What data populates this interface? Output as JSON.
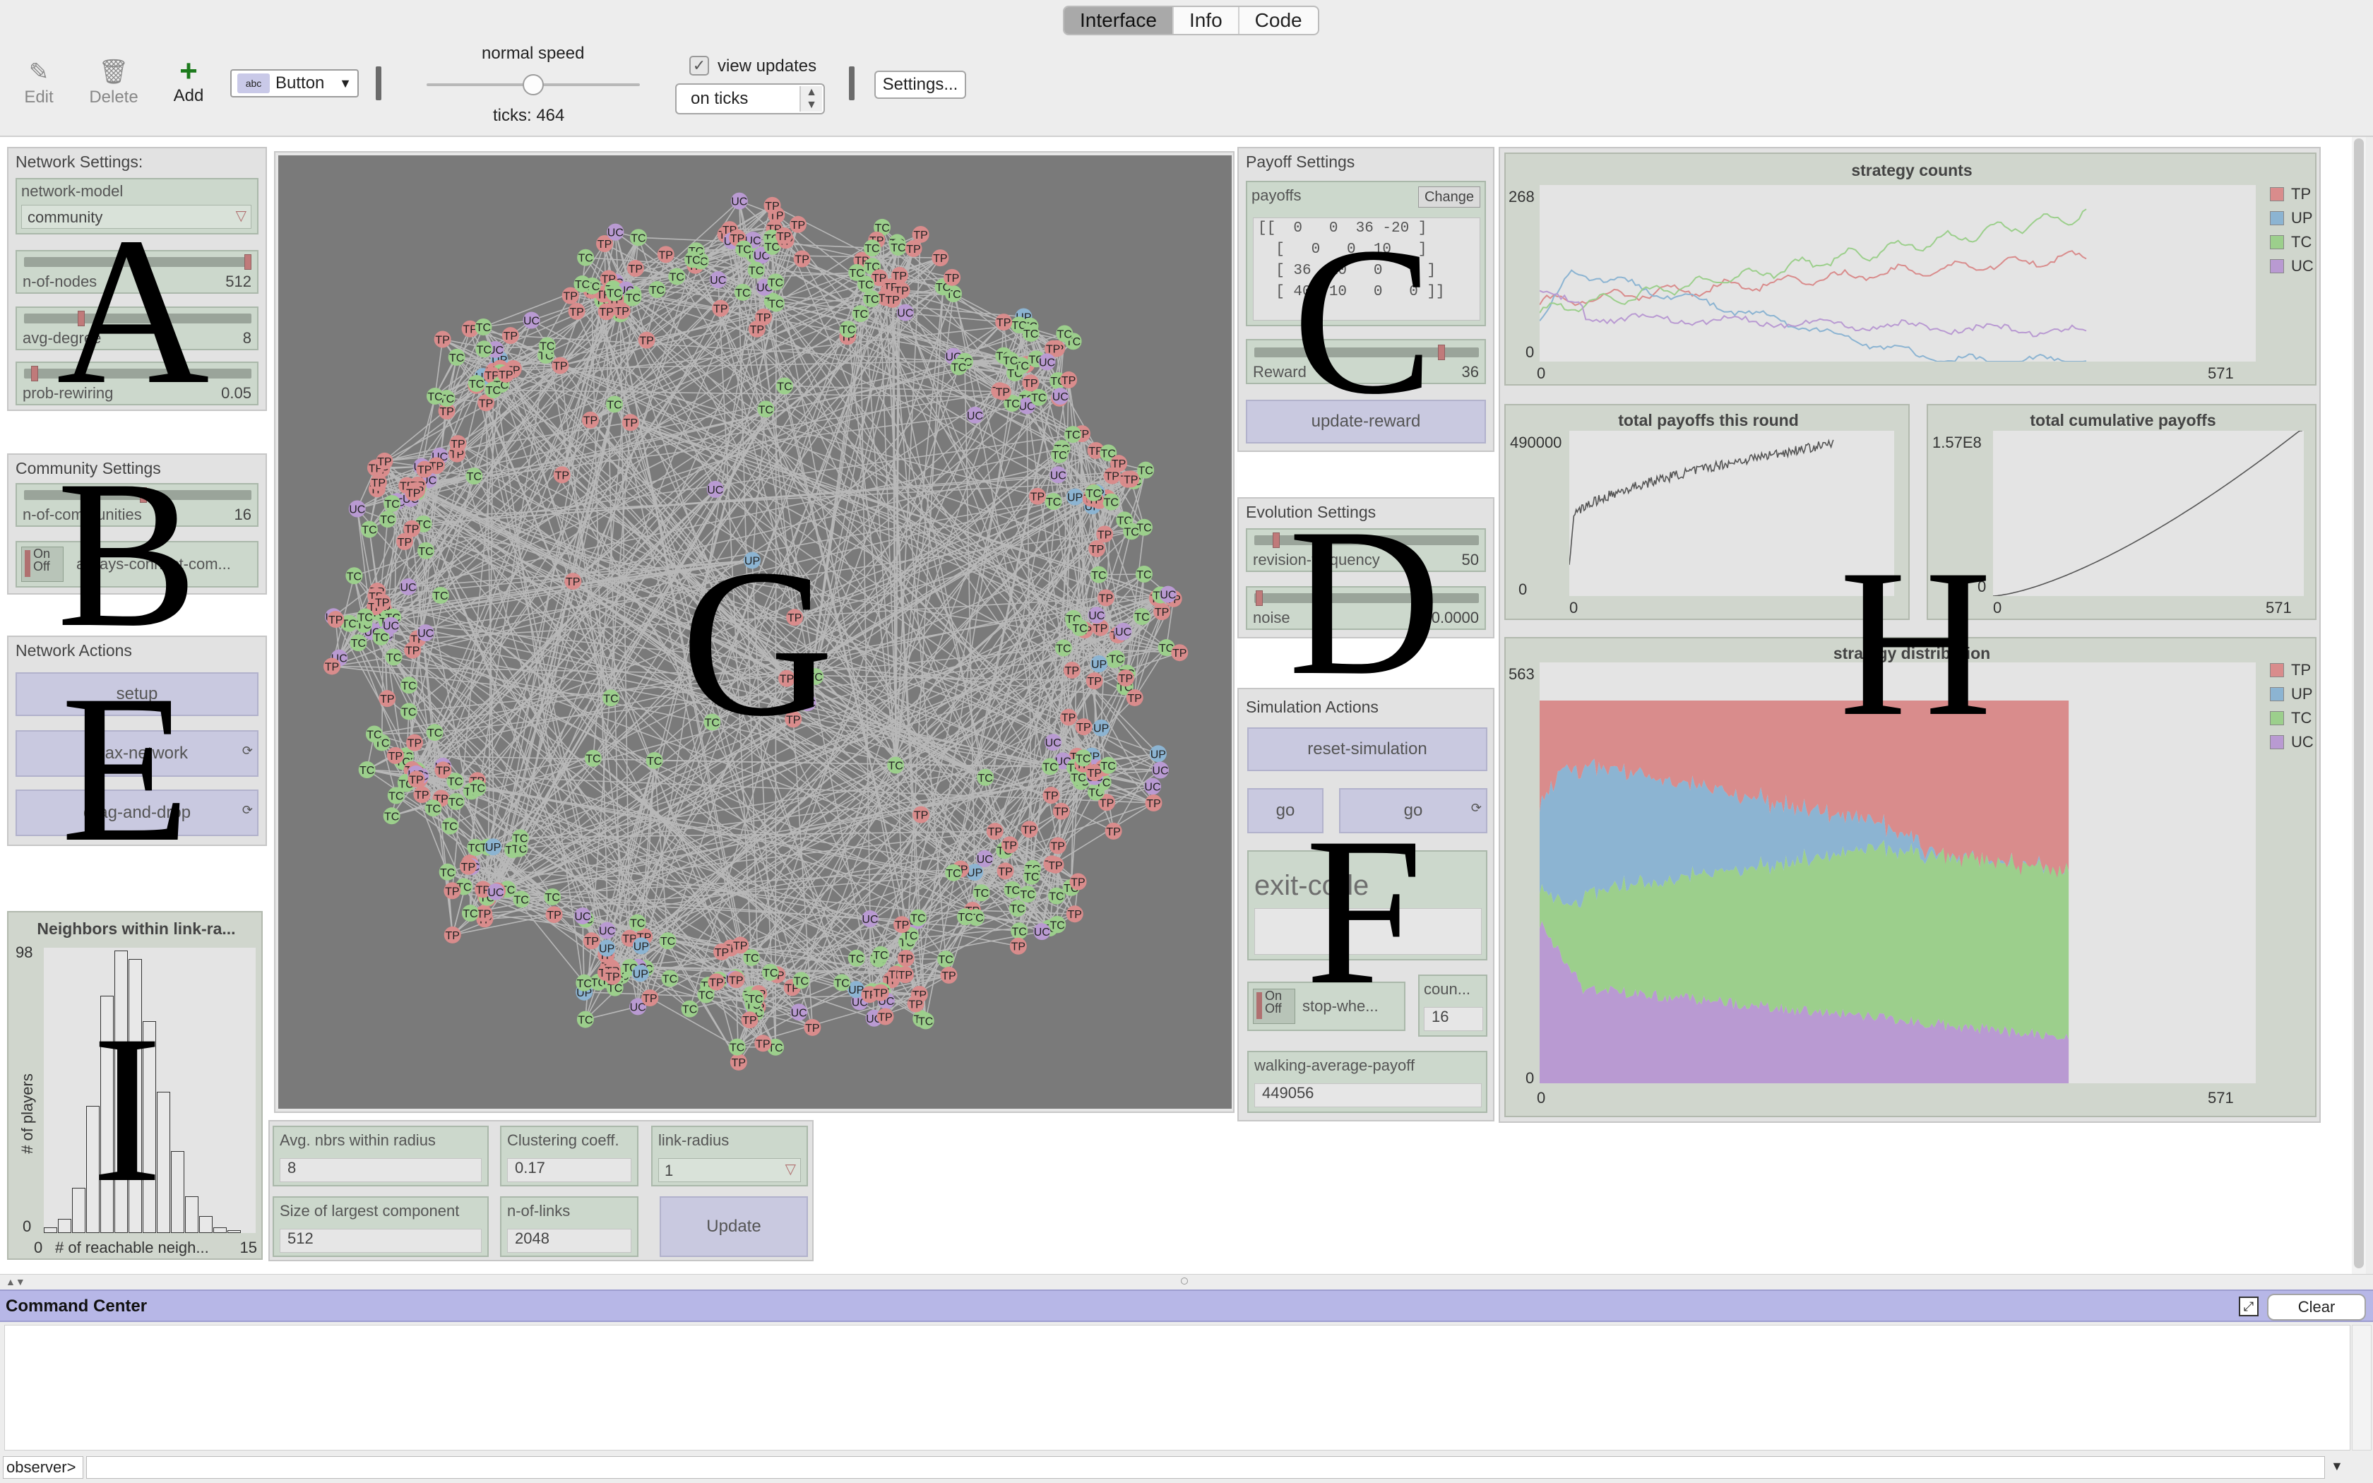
{
  "tabs": [
    "Interface",
    "Info",
    "Code"
  ],
  "toolbar": {
    "edit": "Edit",
    "delete": "Delete",
    "add": "Add",
    "widget_type": "Button",
    "speed_label": "normal speed",
    "ticks": "ticks: 464",
    "view_updates": "view updates",
    "update_mode": "on ticks",
    "settings": "Settings..."
  },
  "network_settings": {
    "title": "Network Settings:",
    "model_label": "network-model",
    "model_value": "community",
    "n_nodes_label": "n-of-nodes",
    "n_nodes_value": "512",
    "avg_degree_label": "avg-degree",
    "avg_degree_value": "8",
    "prob_label": "prob-rewiring",
    "prob_value": "0.05"
  },
  "community_settings": {
    "title": "Community Settings",
    "n_comm_label": "n-of-communities",
    "n_comm_value": "16",
    "switch_on": "On",
    "switch_off": "Off",
    "switch_label": "always-connect-com..."
  },
  "network_actions": {
    "title": "Network Actions",
    "setup": "setup",
    "relax": "relax-network",
    "drag": "drag-and-drop"
  },
  "histogram": {
    "title": "Neighbors within link-ra...",
    "ymax": "98",
    "ymin": "0",
    "xmin": "0",
    "xmax": "15",
    "xlabel": "# of reachable neigh...",
    "ylabel": "# of players",
    "bars": [
      2,
      5,
      16,
      45,
      84,
      100,
      97,
      75,
      50,
      29,
      13,
      6,
      2,
      1,
      0
    ]
  },
  "network_info": {
    "avg_label": "Avg. nbrs within radius",
    "avg_value": "8",
    "clust_label": "Clustering coeff.",
    "clust_value": "0.17",
    "radius_label": "link-radius",
    "radius_value": "1",
    "largest_label": "Size of largest component",
    "largest_value": "512",
    "links_label": "n-of-links",
    "links_value": "2048",
    "update": "Update"
  },
  "payoff": {
    "title": "Payoff Settings",
    "payoffs_label": "payoffs",
    "change": "Change",
    "matrix": [
      "[[  0   0  36 -20 ]",
      "  [   0   0  10   ]",
      "  [ 36  10   0   0 ]",
      "  [ 40  10   0   0 ]]"
    ],
    "reward_label": "Reward",
    "reward_value": "36",
    "update_reward": "update-reward"
  },
  "evolution": {
    "title": "Evolution Settings",
    "rev_label": "revision-frequency",
    "rev_value": "50",
    "noise_label": "noise",
    "noise_value": "0.0000"
  },
  "simulation": {
    "title": "Simulation Actions",
    "reset": "reset-simulation",
    "go_once": "go",
    "go_forever": "go",
    "exit_label": "exit-code",
    "switch_on": "On",
    "switch_off": "Off",
    "stop_label": "stop-whe...",
    "count_label": "coun...",
    "count_value": "16",
    "walk_label": "walking-average-payoff",
    "walk_value": "449056"
  },
  "plots": {
    "strategy_counts": {
      "title": "strategy counts",
      "ymax": "268",
      "ymin": "0",
      "xmin": "0",
      "xmax": "571"
    },
    "payoffs_round": {
      "title": "total payoffs this round",
      "ymax": "490000",
      "ymin": "0",
      "xmin": "0"
    },
    "payoffs_cum": {
      "title": "total cumulative payoffs",
      "ymax": "1.57E8",
      "ymin": "0",
      "xmin": "0",
      "xmax": "571"
    },
    "strategy_dist": {
      "title": "strategy distribution",
      "ymax": "563",
      "ymin": "0",
      "xmin": "0",
      "xmax": "571"
    },
    "legend": [
      {
        "name": "TP",
        "color": "#d98c8c"
      },
      {
        "name": "UP",
        "color": "#8cb4d2"
      },
      {
        "name": "TC",
        "color": "#9ccf8c"
      },
      {
        "name": "UC",
        "color": "#b99ad2"
      }
    ]
  },
  "annotations": {
    "A": "A",
    "B": "B",
    "C": "C",
    "D": "D",
    "E": "E",
    "F": "F",
    "G": "G",
    "H": "H",
    "I": "I"
  },
  "command_center": {
    "title": "Command Center",
    "clear": "Clear",
    "prompt": "observer>"
  },
  "node_labels": [
    "TP",
    "UP",
    "TC",
    "UC"
  ]
}
